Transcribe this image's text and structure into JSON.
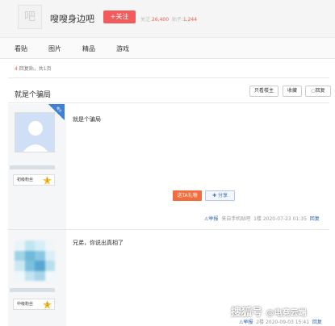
{
  "header": {
    "logo_text": "吧",
    "forum_name": "嗖嗖身边吧",
    "follow_label": "+关注",
    "follow_count_label": "关注:",
    "follow_count": "26,400",
    "post_count_label": "贴子:",
    "post_count": "1,244"
  },
  "nav": {
    "items": [
      {
        "label": "看贴"
      },
      {
        "label": "图片"
      },
      {
        "label": "精品"
      },
      {
        "label": "游戏"
      }
    ]
  },
  "page_info": {
    "reply_count": "4",
    "text": "回复贴，共1页"
  },
  "thread": {
    "title": "就是个骗局",
    "only_op_label": "只看楼主",
    "favorite_label": "收藏",
    "reply_label": "回复"
  },
  "posts": [
    {
      "badge": "楼主",
      "level_name": "初级粉丝",
      "level": "1",
      "content": "就是个骗局",
      "gift_label": "送TA礼物",
      "share_label": "分享",
      "report_label": "举报",
      "source": "来自手机贴吧",
      "floor": "1楼",
      "time": "2020-07-23 01:35",
      "reply_label": "回复"
    },
    {
      "level_name": "中级粉丝",
      "level": "3",
      "content": "兄弟，你说出真相了",
      "report_label": "举报",
      "floor": "2楼",
      "time": "2020-09-03 15:41",
      "reply_label": "回复"
    }
  ],
  "watermark": {
    "brand": "搜狐号",
    "account": "@电竞云端"
  },
  "colors": {
    "accent_red": "#f25b5b",
    "link_blue": "#2d64b3",
    "badge_blue": "#3f7fd4",
    "gift_orange": "#f26c3d"
  }
}
